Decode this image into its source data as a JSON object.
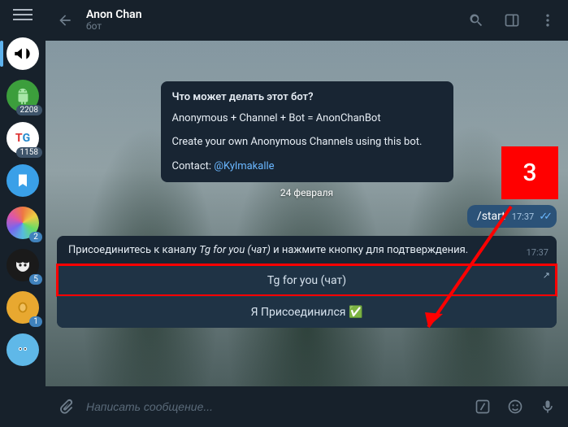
{
  "header": {
    "title": "Anon Chan",
    "subtitle": "бот"
  },
  "sidebar": {
    "items": [
      {
        "badge": ""
      },
      {
        "badge": "2208"
      },
      {
        "badge": "1158",
        "label": "TG"
      },
      {
        "badge": ""
      },
      {
        "badge": "2"
      },
      {
        "badge": "5"
      },
      {
        "badge": "1"
      },
      {
        "badge": ""
      }
    ]
  },
  "intro": {
    "heading": "Что может делать этот бот?",
    "line1": "Anonymous + Channel + Bot = AnonChanBot",
    "line2": "Create your own Anonymous Channels using this bot.",
    "contact_label": "Contact: ",
    "contact_handle": "@Kylmakalle"
  },
  "date_separator": "24 февраля",
  "outgoing": {
    "text": "/start",
    "time": "17:37"
  },
  "incoming": {
    "text_pre": "Присоединитесь к каналу ",
    "text_em": "Tg for you (чат)",
    "text_post": " и нажмите кнопку для подтверждения.",
    "time": "17:37",
    "buttons": [
      {
        "label": "Tg for you (чат)",
        "external": true
      },
      {
        "label": "Я Присоединился ✅",
        "external": false
      }
    ]
  },
  "compose": {
    "placeholder": "Написать сообщение..."
  },
  "annotation": {
    "num": "3"
  }
}
